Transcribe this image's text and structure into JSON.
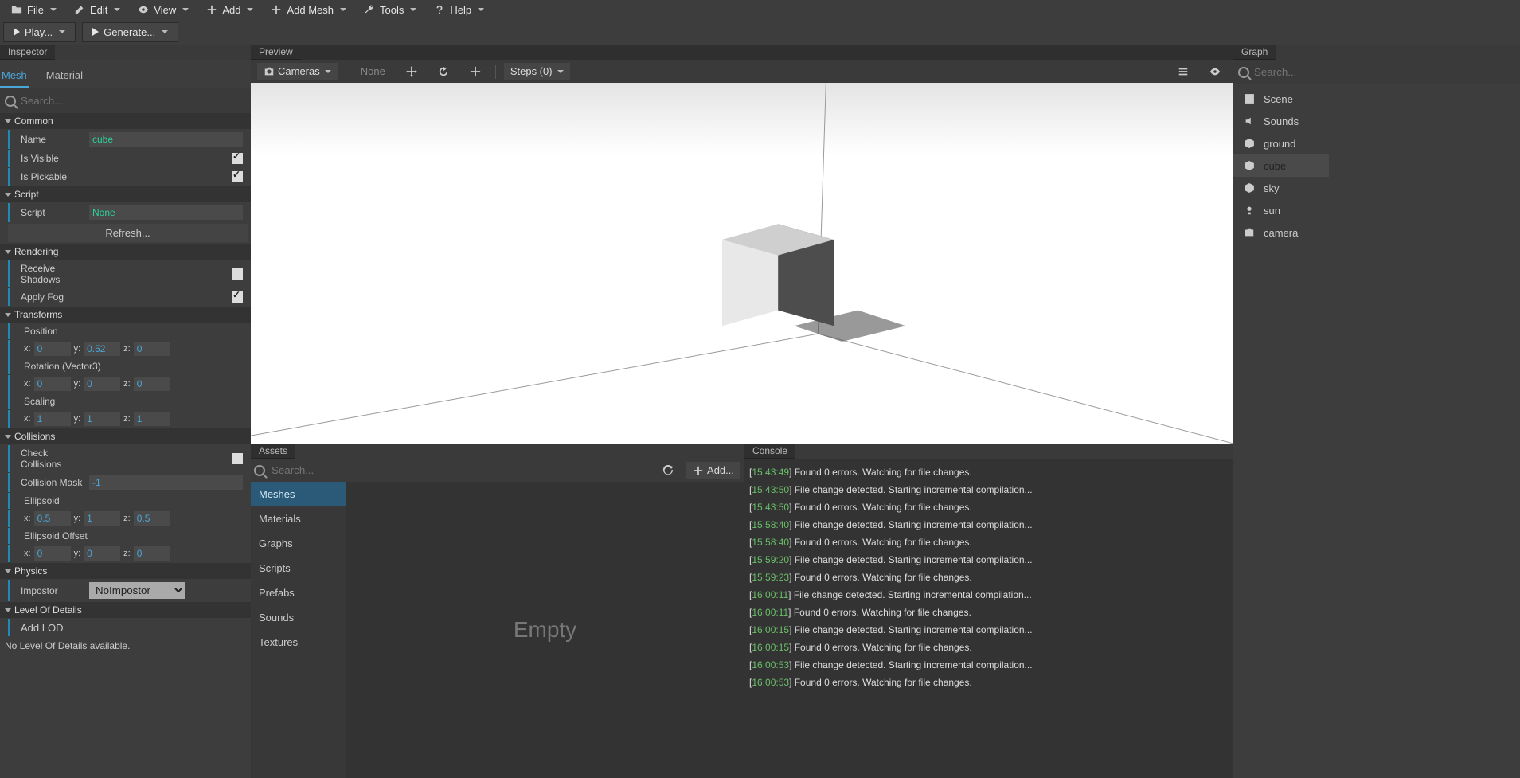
{
  "menus": {
    "file": "File",
    "edit": "Edit",
    "view": "View",
    "add": "Add",
    "add_mesh": "Add Mesh",
    "tools": "Tools",
    "help": "Help",
    "play": "Play...",
    "generate": "Generate..."
  },
  "inspector": {
    "title": "Inspector",
    "tabs": {
      "mesh": "Mesh",
      "material": "Material"
    },
    "search_ph": "Search...",
    "sections": {
      "common": {
        "title": "Common",
        "name_lbl": "Name",
        "name_val": "cube",
        "visible_lbl": "Is Visible",
        "pickable_lbl": "Is Pickable"
      },
      "script": {
        "title": "Script",
        "script_lbl": "Script",
        "script_val": "None",
        "refresh": "Refresh..."
      },
      "rendering": {
        "title": "Rendering",
        "shadows_lbl": "Receive Shadows",
        "fog_lbl": "Apply Fog"
      },
      "transforms": {
        "title": "Transforms",
        "position": "Position",
        "rotation": "Rotation (Vector3)",
        "scaling": "Scaling",
        "pos": {
          "x": "0",
          "y": "0.52",
          "z": "0"
        },
        "rot": {
          "x": "0",
          "y": "0",
          "z": "0"
        },
        "scl": {
          "x": "1",
          "y": "1",
          "z": "1"
        }
      },
      "collisions": {
        "title": "Collisions",
        "check_lbl": "Check Collisions",
        "mask_lbl": "Collision Mask",
        "mask_val": "-1",
        "ellipsoid": "Ellipsoid",
        "ell": {
          "x": "0.5",
          "y": "1",
          "z": "0.5"
        },
        "ellipsoid_off": "Ellipsoid Offset",
        "elloff": {
          "x": "0",
          "y": "0",
          "z": "0"
        }
      },
      "physics": {
        "title": "Physics",
        "impostor_lbl": "Impostor",
        "impostor_val": "NoImpostor"
      },
      "lod": {
        "title": "Level Of Details",
        "add": "Add LOD",
        "none": "No Level Of Details available."
      }
    },
    "axis": {
      "x": "x:",
      "y": "y:",
      "z": "z:"
    }
  },
  "preview": {
    "title": "Preview",
    "cameras": "Cameras",
    "none": "None",
    "steps": "Steps (0)"
  },
  "assets": {
    "title": "Assets",
    "search_ph": "Search...",
    "add": "Add...",
    "empty": "Empty",
    "cats": [
      "Meshes",
      "Materials",
      "Graphs",
      "Scripts",
      "Prefabs",
      "Sounds",
      "Textures"
    ]
  },
  "console": {
    "title": "Console",
    "lines": [
      {
        "t": "15:43:49",
        "m": "] Found 0 errors. Watching for file changes."
      },
      {
        "t": "15:43:50",
        "m": "] File change detected. Starting incremental compilation..."
      },
      {
        "t": "15:43:50",
        "m": "] Found 0 errors. Watching for file changes."
      },
      {
        "t": "15:58:40",
        "m": "] File change detected. Starting incremental compilation..."
      },
      {
        "t": "15:58:40",
        "m": "] Found 0 errors. Watching for file changes."
      },
      {
        "t": "15:59:20",
        "m": "] File change detected. Starting incremental compilation..."
      },
      {
        "t": "15:59:23",
        "m": "] Found 0 errors. Watching for file changes."
      },
      {
        "t": "16:00:11",
        "m": "] File change detected. Starting incremental compilation..."
      },
      {
        "t": "16:00:11",
        "m": "] Found 0 errors. Watching for file changes."
      },
      {
        "t": "16:00:15",
        "m": "] File change detected. Starting incremental compilation..."
      },
      {
        "t": "16:00:15",
        "m": "] Found 0 errors. Watching for file changes."
      },
      {
        "t": "16:00:53",
        "m": "] File change detected. Starting incremental compilation..."
      },
      {
        "t": "16:00:53",
        "m": "] Found 0 errors. Watching for file changes."
      }
    ]
  },
  "graph": {
    "title": "Graph",
    "search_ph": "Search...",
    "items": [
      {
        "icon": "scene",
        "label": "Scene"
      },
      {
        "icon": "sound",
        "label": "Sounds"
      },
      {
        "icon": "mesh",
        "label": "ground"
      },
      {
        "icon": "mesh",
        "label": "cube",
        "selected": true
      },
      {
        "icon": "mesh",
        "label": "sky"
      },
      {
        "icon": "light",
        "label": "sun"
      },
      {
        "icon": "camera",
        "label": "camera"
      }
    ]
  }
}
